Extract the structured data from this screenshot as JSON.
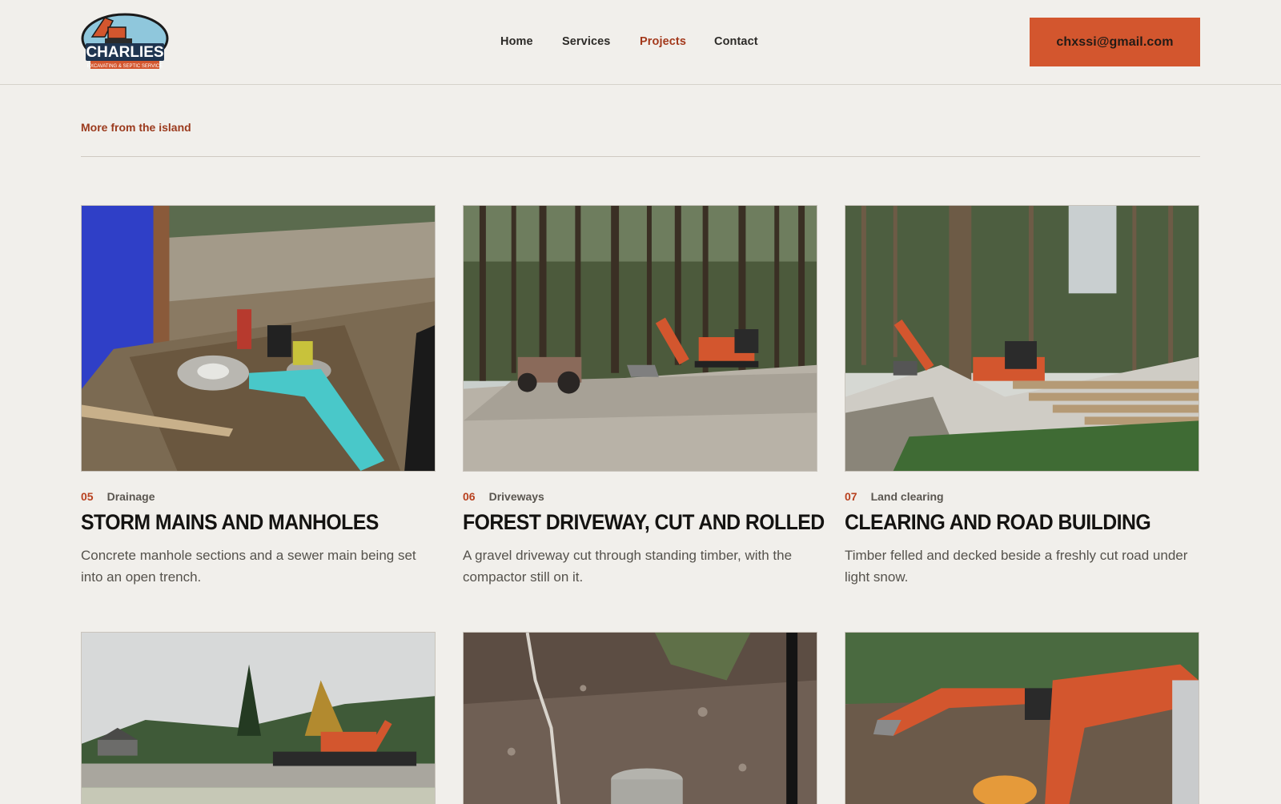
{
  "header": {
    "logo_text": "CHARLIES",
    "logo_subtext": "EXCAVATING & SEPTIC SERVICE",
    "nav": [
      {
        "label": "Home",
        "active": false
      },
      {
        "label": "Services",
        "active": false
      },
      {
        "label": "Projects",
        "active": true
      },
      {
        "label": "Contact",
        "active": false
      }
    ],
    "email_button": "chxssi@gmail.com"
  },
  "section": {
    "eyebrow": "More from the island"
  },
  "projects": [
    {
      "num": "05",
      "category": "Drainage",
      "title": "STORM MAINS AND MANHOLES",
      "description": "Concrete manhole sections and a sewer main being set into an open trench."
    },
    {
      "num": "06",
      "category": "Driveways",
      "title": "FOREST DRIVEWAY, CUT AND ROLLED",
      "description": "A gravel driveway cut through standing timber, with the compactor still on it."
    },
    {
      "num": "07",
      "category": "Land clearing",
      "title": "CLEARING AND ROAD BUILDING",
      "description": "Timber felled and decked beside a freshly cut road under light snow."
    }
  ],
  "colors": {
    "background": "#f1efeb",
    "accent": "#d3562e",
    "accent_text": "#a3391c"
  }
}
